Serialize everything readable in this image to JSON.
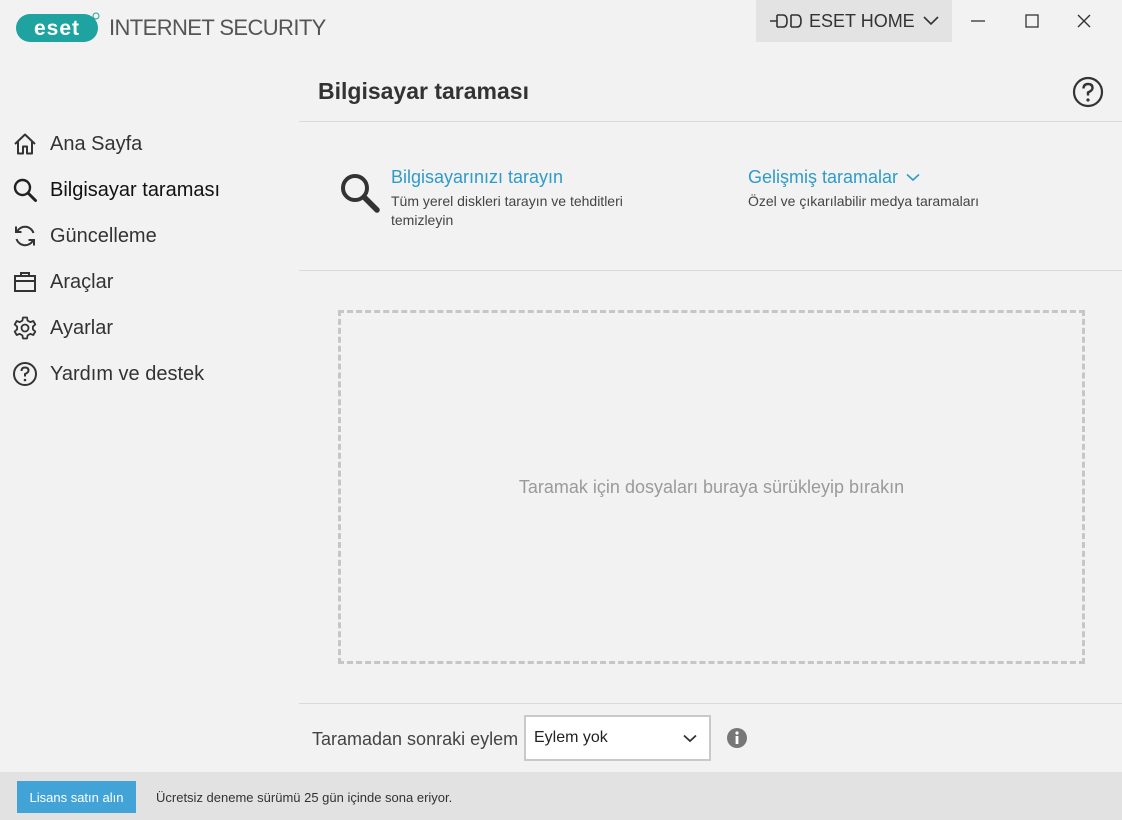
{
  "app": {
    "brand_logo": "eset",
    "product_name": "INTERNET SECURITY",
    "home_label": "ESET HOME"
  },
  "window_controls": [
    "minimize-icon",
    "maximize-icon",
    "close-icon"
  ],
  "sidebar": {
    "items": [
      {
        "label": "Ana Sayfa",
        "icon": "home-icon",
        "active": false
      },
      {
        "label": "Bilgisayar taraması",
        "icon": "search-icon",
        "active": true
      },
      {
        "label": "Güncelleme",
        "icon": "refresh-icon",
        "active": false
      },
      {
        "label": "Araçlar",
        "icon": "toolbox-icon",
        "active": false
      },
      {
        "label": "Ayarlar",
        "icon": "gear-icon",
        "active": false
      },
      {
        "label": "Yardım ve destek",
        "icon": "help-circle-icon",
        "active": false
      }
    ]
  },
  "main": {
    "title": "Bilgisayar taraması",
    "scan_computer": {
      "title": "Bilgisayarınızı tarayın",
      "description": "Tüm yerel diskleri tarayın ve tehditleri temizleyin"
    },
    "advanced_scans": {
      "title": "Gelişmiş taramalar",
      "description": "Özel ve çıkarılabilir medya taramaları"
    },
    "drop_zone_text": "Taramak için dosyaları buraya sürükleyip bırakın",
    "after_scan_label": "Taramadan sonraki eylem",
    "after_scan_value": "Eylem yok"
  },
  "footer": {
    "buy_label": "Lisans satın alın",
    "trial_text": "Ücretsiz deneme sürümü 25 gün içinde sona eriyor."
  },
  "colors": {
    "accent": "#2e9bc9",
    "brand": "#1fa3a1",
    "button": "#42a3d6",
    "background": "#f2f2f2"
  }
}
